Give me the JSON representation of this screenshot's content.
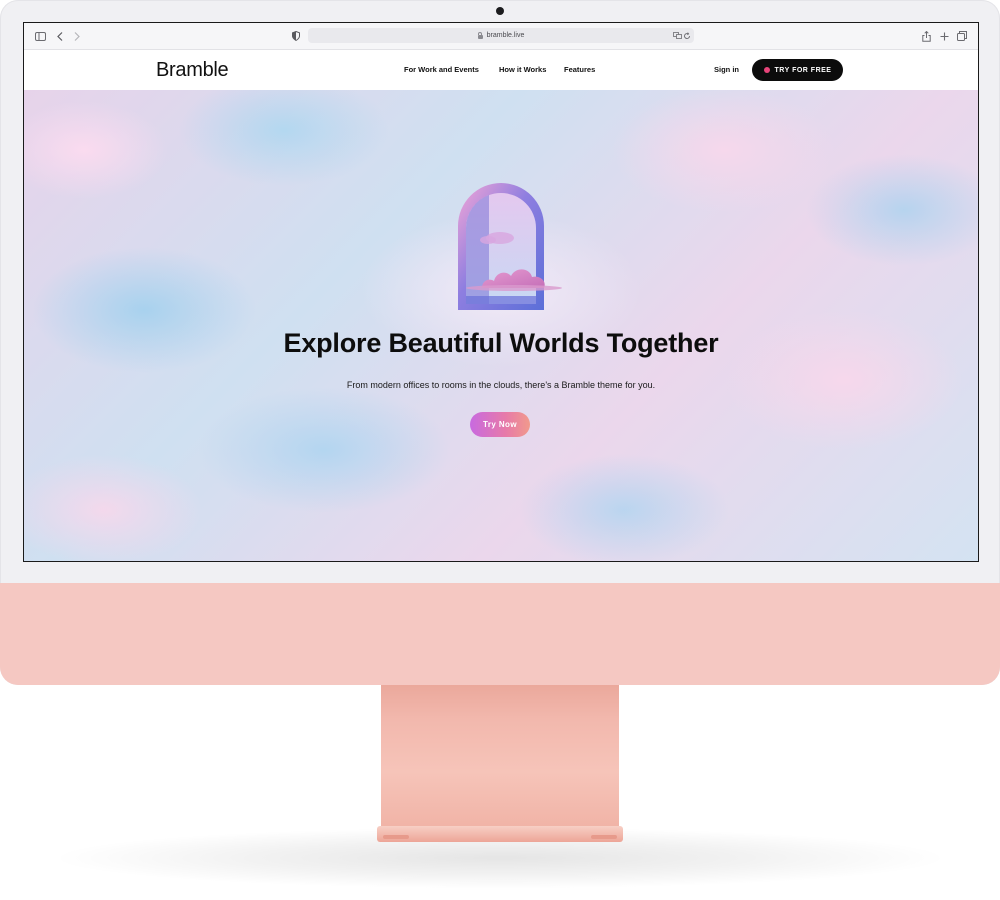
{
  "browser": {
    "url": "bramble.live",
    "icons": {
      "sidebar": "sidebar-icon",
      "back": "chevron-left-icon",
      "forward": "chevron-right-icon",
      "privacy": "shield-icon",
      "translate": "translate-icon",
      "reload": "reload-icon",
      "share": "share-icon",
      "new_tab": "plus-icon",
      "tabs": "tabs-overview-icon"
    }
  },
  "site": {
    "brand": "Bramble",
    "nav": [
      {
        "label": "For Work and Events"
      },
      {
        "label": "How it Works"
      },
      {
        "label": "Features"
      }
    ],
    "sign_in": "Sign in",
    "cta": "TRY FOR FREE"
  },
  "hero": {
    "title": "Explore Beautiful Worlds Together",
    "subtitle": "From modern offices to rooms in the clouds, there's a Bramble theme for you.",
    "button": "Try Now"
  },
  "colors": {
    "imac_chin": "#f5c8c2",
    "cta_dot": "#e8447a",
    "button_gradient_start": "#c86ae0",
    "button_gradient_end": "#f19a8c"
  }
}
